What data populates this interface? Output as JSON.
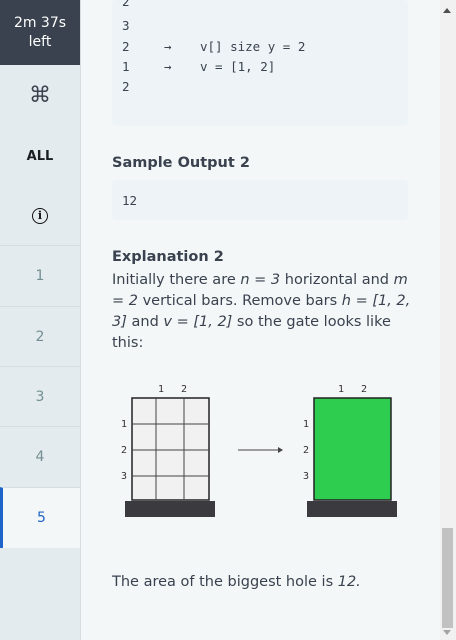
{
  "timer": {
    "line1": "2m 37s",
    "line2": "left"
  },
  "sidebar": {
    "cmd_icon": "⌘",
    "all_label": "ALL",
    "info_icon": "i",
    "items": [
      "1",
      "2",
      "3",
      "4",
      "5"
    ],
    "active_index": 4
  },
  "code_lines": [
    {
      "value": "2",
      "arrow": "",
      "note": ""
    },
    {
      "value": "3",
      "arrow": "",
      "note": ""
    },
    {
      "value": "2",
      "arrow": "→",
      "note": "v[] size y = 2"
    },
    {
      "value": "1",
      "arrow": "→",
      "note": "v = [1, 2]"
    },
    {
      "value": "2",
      "arrow": "",
      "note": ""
    }
  ],
  "sample_output_title": "Sample Output 2",
  "sample_output_value": "12",
  "explanation_title": "Explanation 2",
  "explanation": {
    "p1": "Initially there are ",
    "n_eq": "n = 3",
    "p2": " horizontal and ",
    "m_eq": "m = 2",
    "p3": " vertical bars. Remove bars ",
    "h_eq": "h = [1, 2, 3]",
    "p4": " and ",
    "v_eq": "v = [1, 2]",
    "p5": " so the gate looks like this:"
  },
  "diagram": {
    "col_labels": [
      "1",
      "2"
    ],
    "row_labels": [
      "1",
      "2",
      "3"
    ],
    "arrow": "→",
    "fill_color": "#2ecc4f",
    "base_color": "#3b3b3f"
  },
  "result": {
    "text": "The area of the biggest hole is ",
    "value": "12."
  },
  "colors": {
    "accent": "#1f64c8",
    "timer_bg": "#39424e"
  }
}
